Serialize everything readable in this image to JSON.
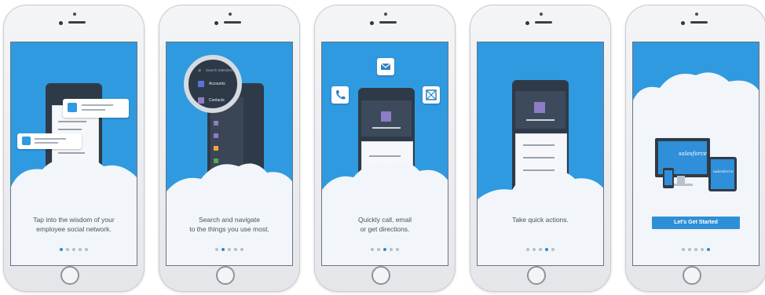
{
  "screens": [
    {
      "caption_line1": "Tap into the wisdom of your",
      "caption_line2": "employee social network.",
      "active_dot": 0
    },
    {
      "caption_line1": "Search and navigate",
      "caption_line2": "to the things you use most.",
      "active_dot": 1,
      "search_placeholder": "Search Salesforce",
      "menu_accounts": "Accounts",
      "menu_contacts": "Contacts"
    },
    {
      "caption_line1": "Quickly call, email",
      "caption_line2": "or get directions.",
      "active_dot": 2
    },
    {
      "caption_line1": "Take quick actions.",
      "caption_line2": "",
      "active_dot": 3
    },
    {
      "cta_label": "Let's Get Started",
      "brand": "salesforce",
      "active_dot": 4
    }
  ],
  "colors": {
    "screen_bg": "#2f9ae0",
    "accent": "#2d8fd8",
    "active_dot": "#2a8bd6",
    "inactive_dot": "#b8bec6"
  },
  "icons": [
    "phone-icon",
    "email-icon",
    "map-icon",
    "add-icon",
    "search-icon"
  ]
}
